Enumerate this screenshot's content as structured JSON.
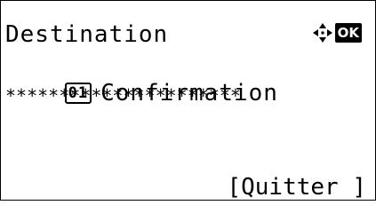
{
  "screen": {
    "title": "Destination",
    "nav_icon": "four-way-arrows-icon",
    "ok_label": "OK",
    "item": {
      "number": "01",
      "label": "Confirmation"
    },
    "masked_value": "**********************",
    "softkey_label": "[Quitter ]"
  }
}
